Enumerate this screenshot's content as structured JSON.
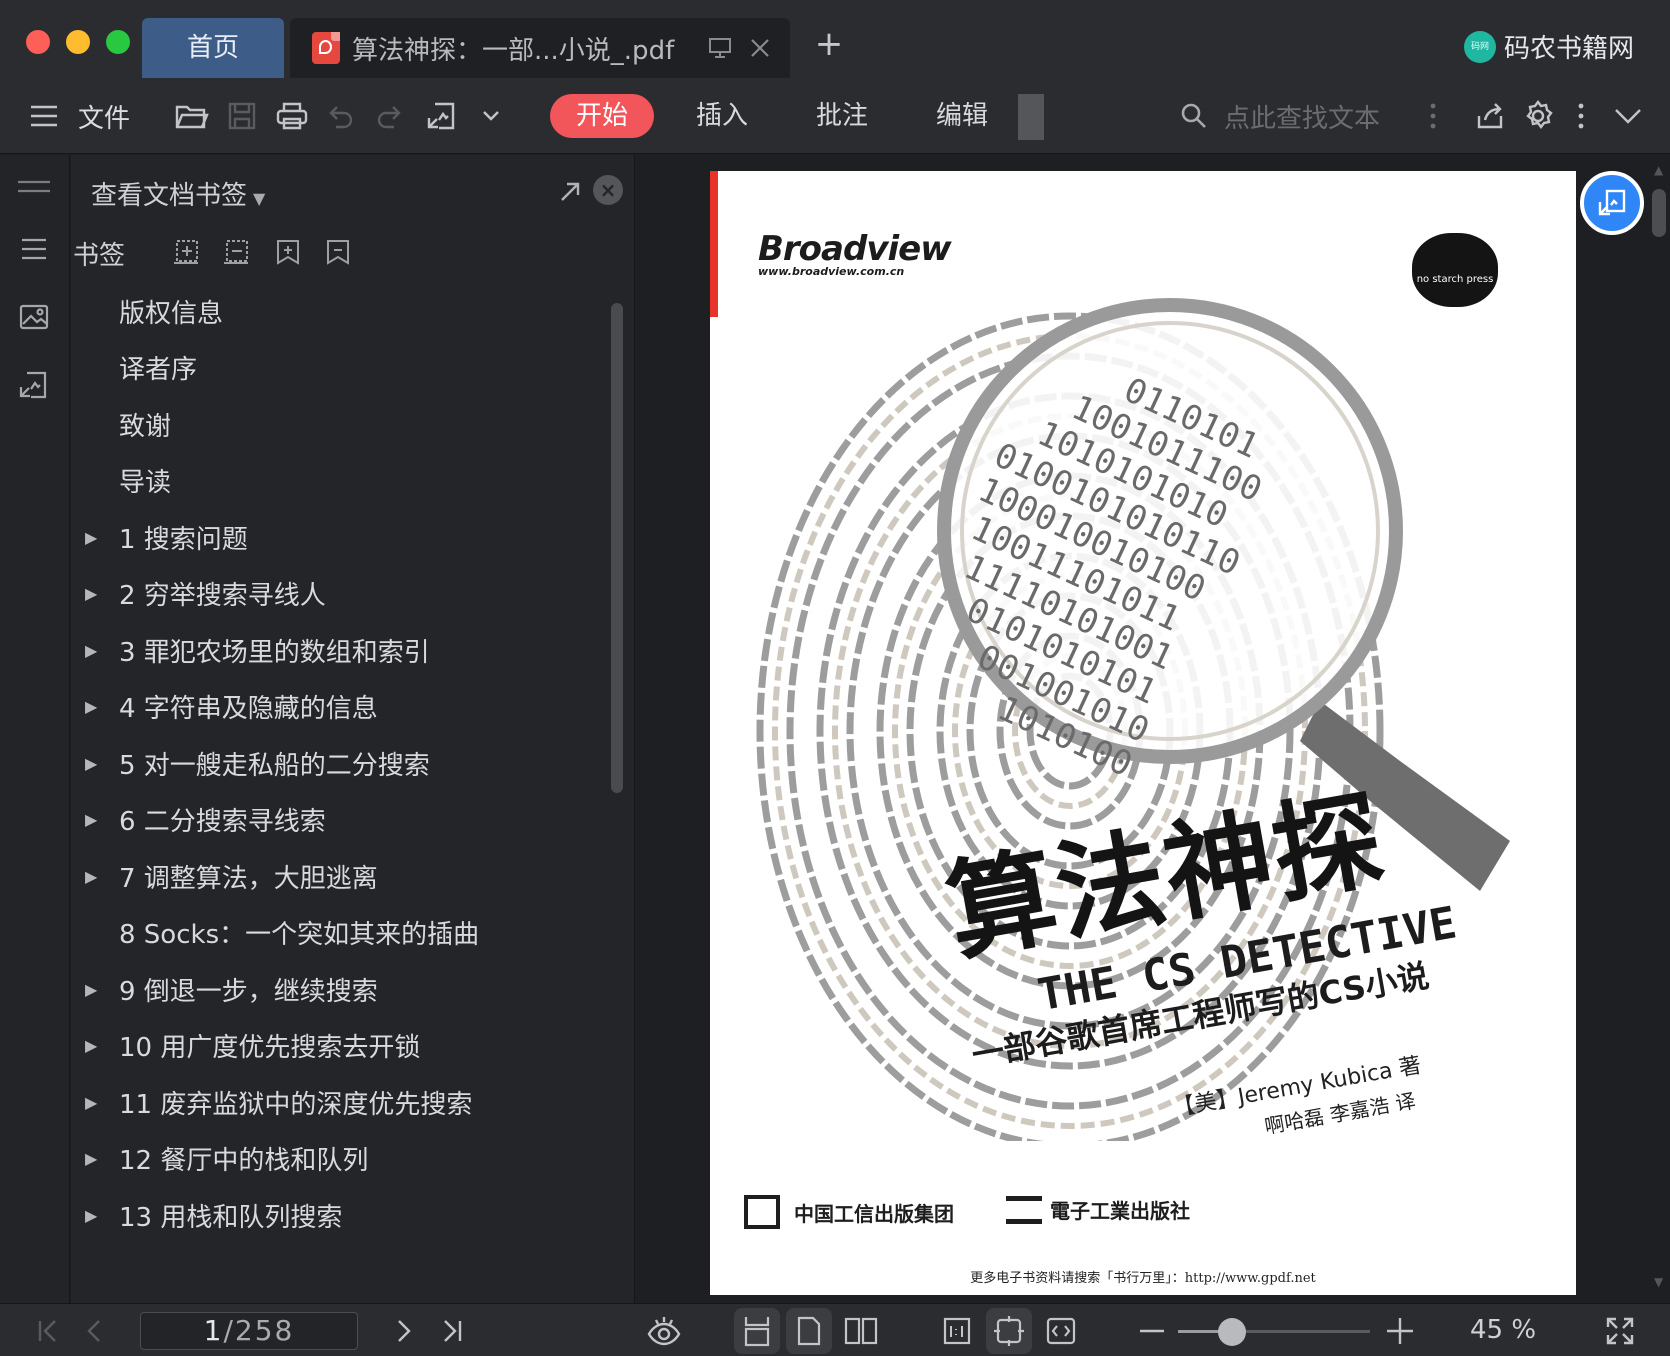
{
  "window": {
    "tabs": {
      "home": "首页",
      "document": "算法神探：一部...小说_.pdf"
    },
    "brand": "码农书籍网",
    "brand_logo_text": "码网"
  },
  "toolbar": {
    "file_menu": "文件",
    "tabs": [
      {
        "label": "开始",
        "active": true
      },
      {
        "label": "插入",
        "active": false
      },
      {
        "label": "批注",
        "active": false
      },
      {
        "label": "编辑",
        "active": false
      }
    ],
    "search_placeholder": "点此查找文本",
    "accent_color": "#f2555a"
  },
  "bookmark_panel": {
    "header": "查看文档书签",
    "section_label": "书签",
    "items": [
      {
        "label": "版权信息",
        "expandable": false
      },
      {
        "label": "译者序",
        "expandable": false
      },
      {
        "label": "致谢",
        "expandable": false
      },
      {
        "label": "导读",
        "expandable": false
      },
      {
        "label": "1 搜索问题",
        "expandable": true
      },
      {
        "label": "2 穷举搜索寻线人",
        "expandable": true
      },
      {
        "label": "3 罪犯农场里的数组和索引",
        "expandable": true
      },
      {
        "label": "4 字符串及隐藏的信息",
        "expandable": true
      },
      {
        "label": "5 对一艘走私船的二分搜索",
        "expandable": true
      },
      {
        "label": "6 二分搜索寻线索",
        "expandable": true
      },
      {
        "label": "7 调整算法，大胆逃离",
        "expandable": true
      },
      {
        "label": "8 Socks：一个突如其来的插曲",
        "expandable": false
      },
      {
        "label": "9 倒退一步，继续搜索",
        "expandable": true
      },
      {
        "label": "10 用广度优先搜索去开锁",
        "expandable": true
      },
      {
        "label": "11 废弃监狱中的深度优先搜索",
        "expandable": true
      },
      {
        "label": "12 餐厅中的栈和队列",
        "expandable": true
      },
      {
        "label": "13 用栈和队列搜索",
        "expandable": true
      }
    ]
  },
  "cover": {
    "publisher_logo": "Broadview",
    "publisher_url": "www.broadview.com.cn",
    "imprint": "no starch press",
    "binary_text": "0110101 1001011100 1010101010 0100101010110 100010010100 10011101011 11110101001 0101010101 001001010 1010100",
    "title_zh": "算法神探",
    "title_en": "THE CS DETECTIVE",
    "subtitle_zh": "一部谷歌首席工程师写的CS小说",
    "author": "【美】Jeremy Kubica 著",
    "translator": "啊哈磊 李嘉浩 译",
    "publisher_1": "中国工信出版集团",
    "publisher_2": "電子工業出版社",
    "footnote": "更多电子书资料请搜索「书行万里」：http://www.gpdf.net"
  },
  "statusbar": {
    "current_page": "1",
    "total_pages": "/258",
    "zoom_percent": 45,
    "zoom_label": "45 %"
  }
}
